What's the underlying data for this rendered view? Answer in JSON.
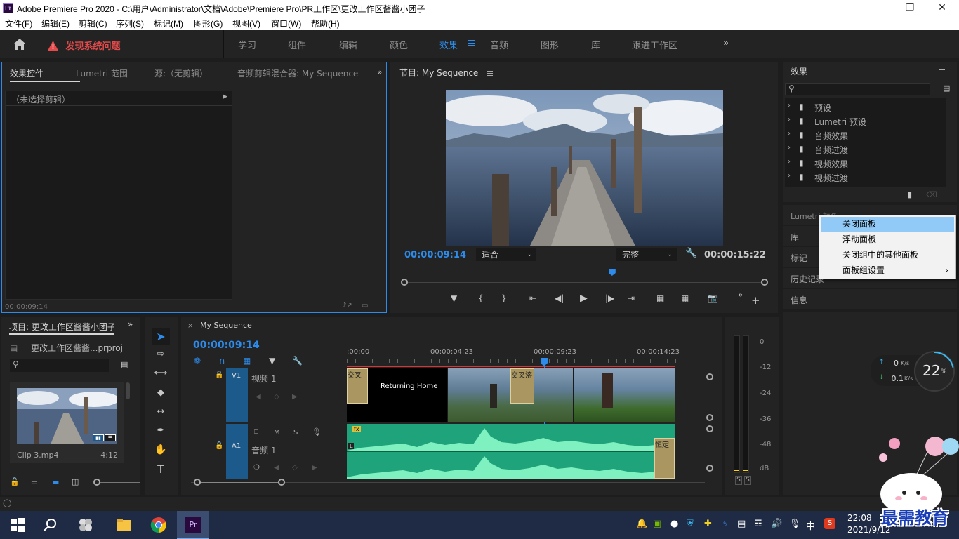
{
  "window": {
    "title": "Adobe Premiere Pro 2020 - C:\\用户\\Administrator\\文档\\Adobe\\Premiere Pro\\PR工作区\\更改工作区酱酱小团子",
    "logo": "Pr"
  },
  "menu": [
    "文件(F)",
    "编辑(E)",
    "剪辑(C)",
    "序列(S)",
    "标记(M)",
    "图形(G)",
    "视图(V)",
    "窗口(W)",
    "帮助(H)"
  ],
  "workspace": {
    "warning": "发现系统问题",
    "tabs": [
      "学习",
      "组件",
      "编辑",
      "颜色",
      "效果",
      "音频",
      "图形",
      "库",
      "跟进工作区"
    ],
    "active_tab": "效果"
  },
  "effect_controls": {
    "tabs": [
      "效果控件",
      "Lumetri 范围",
      "源:（无剪辑）",
      "音频剪辑混合器: My Sequence"
    ],
    "no_clip": "（未选择剪辑）",
    "timecode": "00:00:09:14"
  },
  "program_monitor": {
    "title": "节目: My Sequence",
    "timecode": "00:00:09:14",
    "fit": "适合",
    "quality": "完整",
    "duration": "00:00:15:22",
    "playhead_pos": 0.58
  },
  "effects_panel": {
    "title": "效果",
    "items": [
      "预设",
      "Lumetri 预设",
      "音频效果",
      "音频过渡",
      "视频效果",
      "视频过渡"
    ]
  },
  "right_panels": [
    "Lumetri 颜色",
    "库",
    "标记",
    "历史记录",
    "信息"
  ],
  "context_menu": {
    "items": [
      "关闭面板",
      "浮动面板",
      "关闭组中的其他面板",
      "面板组设置"
    ],
    "highlighted": "关闭面板"
  },
  "project": {
    "title": "项目: 更改工作区酱酱小团子",
    "file": "更改工作区酱酱...prproj",
    "clip_name": "Clip 3.mp4",
    "clip_duration": "4:12"
  },
  "timeline": {
    "sequence": "My Sequence",
    "timecode": "00:00:09:14",
    "ruler": [
      ":00:00",
      "00:00:04:23",
      "00:00:09:23",
      "00:00:14:23"
    ],
    "v1_label": "V1",
    "v1_name": "视频 1",
    "a1_label": "A1",
    "a1_name": "音频 1",
    "title_clip": "Returning Home",
    "transition_1": "交叉",
    "transition_2": "交叉溶",
    "audio_end": "恒定",
    "audio_m": "M",
    "audio_s": "S",
    "fx": "fx",
    "channel_l": "L"
  },
  "meter": {
    "scale": [
      "0",
      "-12",
      "-24",
      "-36",
      "-48",
      "dB"
    ],
    "solo": [
      "S",
      "S"
    ]
  },
  "network": {
    "up": "0",
    "up_unit": "K/s",
    "down": "0.1",
    "down_unit": "K/s",
    "percent": "22",
    "percent_sign": "%"
  },
  "taskbar": {
    "time": "22:08",
    "date": "2021/9/12",
    "ime": "中",
    "watermark": "最需教育"
  },
  "colors": {
    "accent": "#2d8ceb",
    "warning": "#e54b4b",
    "track_header": "#1c5a8c",
    "audio_clip": "#1fa37a",
    "menu_highlight": "#91c9f7"
  }
}
